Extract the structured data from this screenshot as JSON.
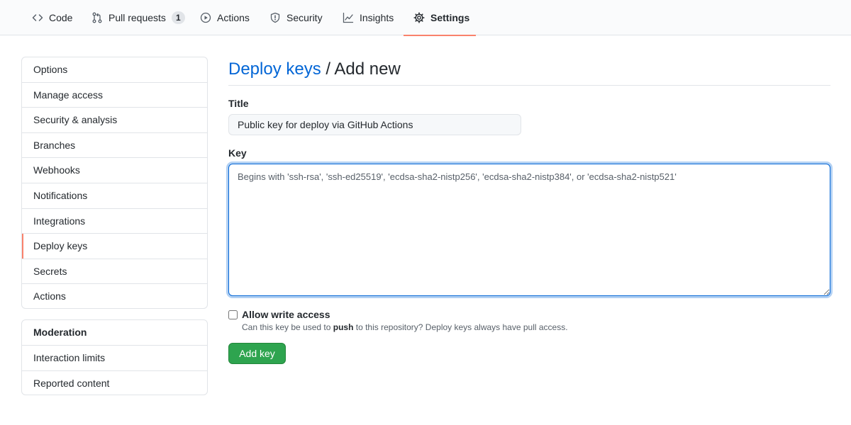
{
  "nav": {
    "tabs": [
      {
        "label": "Code",
        "icon": "code-icon"
      },
      {
        "label": "Pull requests",
        "icon": "git-pull-request-icon",
        "count": "1"
      },
      {
        "label": "Actions",
        "icon": "play-icon"
      },
      {
        "label": "Security",
        "icon": "shield-icon"
      },
      {
        "label": "Insights",
        "icon": "graph-icon"
      },
      {
        "label": "Settings",
        "icon": "gear-icon",
        "active": true
      }
    ]
  },
  "sidebar": {
    "items": [
      "Options",
      "Manage access",
      "Security & analysis",
      "Branches",
      "Webhooks",
      "Notifications",
      "Integrations",
      "Deploy keys",
      "Secrets",
      "Actions"
    ],
    "selected": "Deploy keys",
    "moderation": {
      "heading": "Moderation",
      "items": [
        "Interaction limits",
        "Reported content"
      ]
    }
  },
  "main": {
    "breadcrumb_link": "Deploy keys",
    "breadcrumb_rest": " / Add new",
    "title_label": "Title",
    "title_value": "Public key for deploy via GitHub Actions",
    "key_label": "Key",
    "key_placeholder": "Begins with 'ssh-rsa', 'ssh-ed25519', 'ecdsa-sha2-nistp256', 'ecdsa-sha2-nistp384', or 'ecdsa-sha2-nistp521'",
    "allow_write_label": "Allow write access",
    "allow_write_note_pre": "Can this key be used to ",
    "allow_write_note_bold": "push",
    "allow_write_note_post": " to this repository? Deploy keys always have pull access.",
    "add_button": "Add key"
  },
  "colors": {
    "accent_tab": "#f9826c",
    "link": "#0366d6",
    "primary_button": "#2ea44f"
  }
}
